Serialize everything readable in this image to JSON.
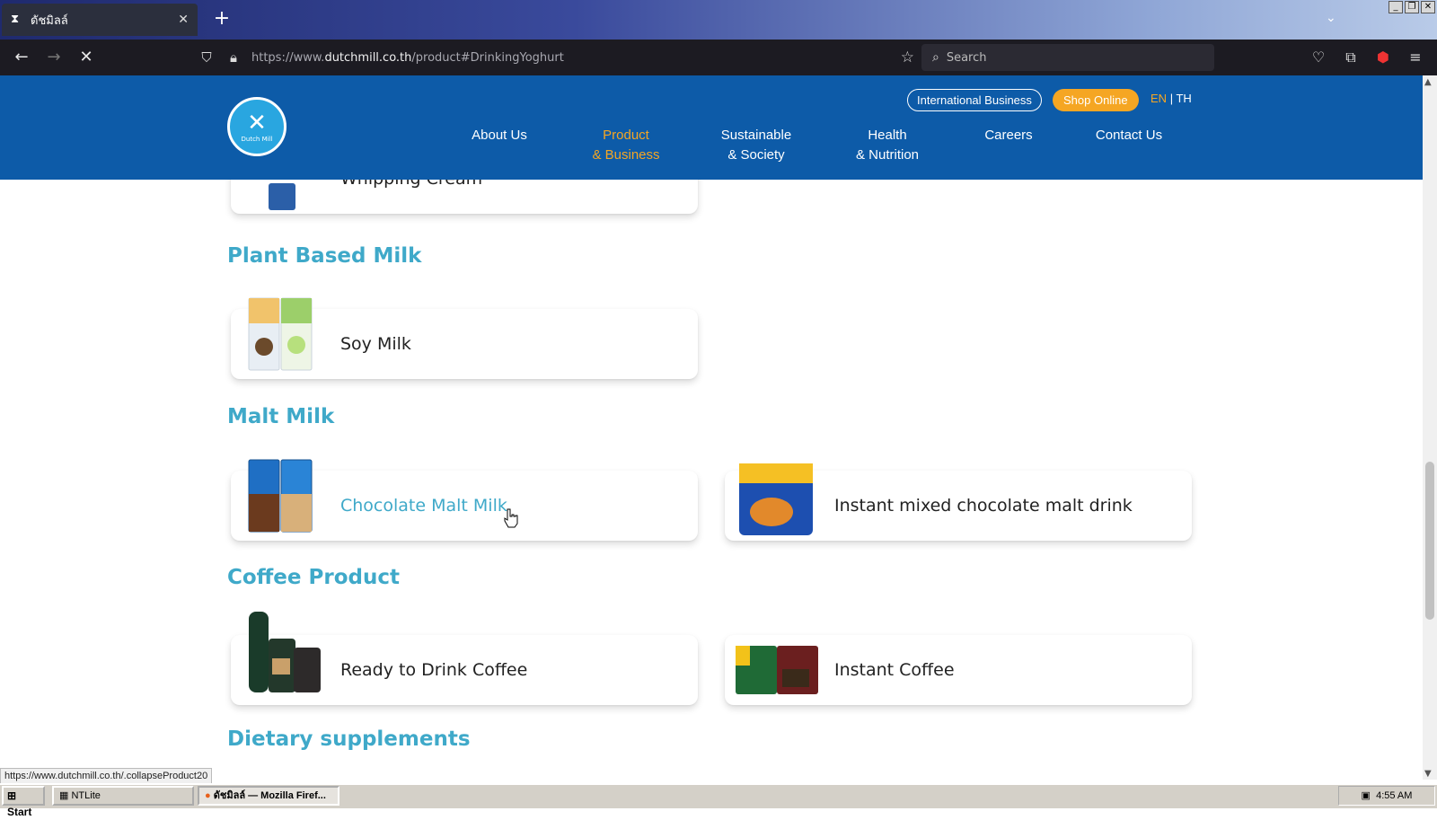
{
  "browser": {
    "tab_title": "ดัชมิลล์",
    "url_prefix": "https://www.",
    "url_domain": "dutchmill.co.th",
    "url_path": "/product#DrinkingYoghurt",
    "search_placeholder": "Search",
    "status_link": "https://www.dutchmill.co.th/.collapseProduct20"
  },
  "header": {
    "logo_text": "Dutch Mill",
    "intl_business": "International Business",
    "shop_online": "Shop Online",
    "lang_en": "EN",
    "lang_sep": "|",
    "lang_th": "TH",
    "menu": [
      {
        "line1": "About Us",
        "line2": ""
      },
      {
        "line1": "Product",
        "line2": "& Business"
      },
      {
        "line1": "Sustainable",
        "line2": "& Society"
      },
      {
        "line1": "Health",
        "line2": "& Nutrition"
      },
      {
        "line1": "Careers",
        "line2": ""
      },
      {
        "line1": "Contact Us",
        "line2": ""
      }
    ]
  },
  "content": {
    "partial_card": "Whipping Cream",
    "sections": [
      {
        "title": "Plant Based Milk",
        "items": [
          "Soy Milk"
        ]
      },
      {
        "title": "Malt Milk",
        "items": [
          "Chocolate Malt Milk",
          "Instant mixed chocolate malt drink"
        ]
      },
      {
        "title": "Coffee Product",
        "items": [
          "Ready to Drink Coffee",
          "Instant Coffee"
        ]
      },
      {
        "title": "Dietary supplements",
        "items": []
      }
    ]
  },
  "taskbar": {
    "start": "Start",
    "items": [
      "NTLite",
      "ดัชมิลล์ — Mozilla Firef..."
    ],
    "clock": "4:55 AM"
  },
  "colors": {
    "header_blue": "#0d5ba8",
    "accent_orange": "#f5a623",
    "section_teal": "#3fa9c9"
  }
}
